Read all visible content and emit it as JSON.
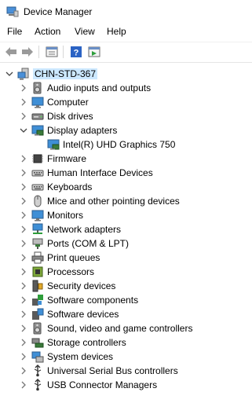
{
  "window": {
    "title": "Device Manager"
  },
  "menu": [
    "File",
    "Action",
    "View",
    "Help"
  ],
  "root": {
    "label": "CHN-STD-367",
    "icon": "computer-icon"
  },
  "categories": [
    {
      "label": "Audio inputs and outputs",
      "icon": "speaker-icon"
    },
    {
      "label": "Computer",
      "icon": "monitor-icon"
    },
    {
      "label": "Disk drives",
      "icon": "disk-drive-icon"
    },
    {
      "label": "Display adapters",
      "icon": "display-adapter-icon",
      "expanded": true,
      "children": [
        {
          "label": "Intel(R) UHD Graphics 750",
          "icon": "display-adapter-icon"
        }
      ]
    },
    {
      "label": "Firmware",
      "icon": "chip-icon"
    },
    {
      "label": "Human Interface Devices",
      "icon": "keyboard-icon"
    },
    {
      "label": "Keyboards",
      "icon": "keyboard-icon"
    },
    {
      "label": "Mice and other pointing devices",
      "icon": "mouse-icon"
    },
    {
      "label": "Monitors",
      "icon": "monitor-icon"
    },
    {
      "label": "Network adapters",
      "icon": "network-icon"
    },
    {
      "label": "Ports (COM & LPT)",
      "icon": "port-icon"
    },
    {
      "label": "Print queues",
      "icon": "printer-icon"
    },
    {
      "label": "Processors",
      "icon": "processor-icon"
    },
    {
      "label": "Security devices",
      "icon": "security-icon"
    },
    {
      "label": "Software components",
      "icon": "puzzle-icon"
    },
    {
      "label": "Software devices",
      "icon": "software-device-icon"
    },
    {
      "label": "Sound, video and game controllers",
      "icon": "speaker-icon"
    },
    {
      "label": "Storage controllers",
      "icon": "storage-controller-icon"
    },
    {
      "label": "System devices",
      "icon": "system-devices-icon"
    },
    {
      "label": "Universal Serial Bus controllers",
      "icon": "usb-icon"
    },
    {
      "label": "USB Connector Managers",
      "icon": "usb-icon"
    }
  ]
}
